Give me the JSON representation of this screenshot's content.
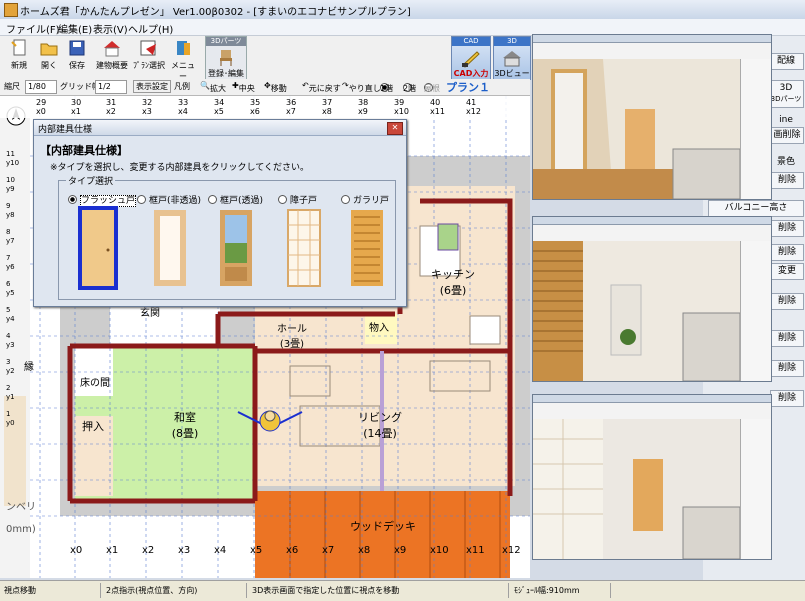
{
  "window": {
    "title": "ホームズ君「かんたんプレゼン」 Ver1.00β0302 - [すまいのエコナビサンプルプラン]"
  },
  "menu": [
    "ファイル(F)",
    "編集(E)",
    "表示(V)",
    "ヘルプ(H)"
  ],
  "toolbar": {
    "buttons": [
      "新規",
      "開く",
      "保存",
      "建物概要",
      "ﾌﾟﾗﾝ選択",
      "メニュー",
      "登録･編集"
    ],
    "parts_group": "3Dパーツ",
    "cad_label": "CAD",
    "cad_button": "CAD入力",
    "view3d_label": "3D",
    "view3d_button": "3Dビュー"
  },
  "toolbar2": {
    "scale_label": "縮尺",
    "scale_value": "1/80",
    "grid_label": "グリッド幅",
    "grid_value": "1/2",
    "display_settings": "表示設定",
    "legend": "凡例",
    "zoom": "拡大",
    "center": "中央",
    "move": "移動",
    "undo": "元に戻す",
    "redo": "やり直し",
    "floor1": "1階",
    "floor2": "2階",
    "roof": "屋根",
    "plan_tab": "プラン１"
  },
  "ruler": {
    "top": [
      "29",
      "30",
      "31",
      "32",
      "33",
      "34",
      "35",
      "36",
      "37",
      "38",
      "39",
      "40",
      "41"
    ],
    "top_sub": [
      "x0",
      "x1",
      "x2",
      "x3",
      "x4",
      "x5",
      "x6",
      "x7",
      "x8",
      "x9",
      "x10",
      "x11",
      "x12"
    ],
    "bottom": [
      "x0",
      "x1",
      "x2",
      "x3",
      "x4",
      "x5",
      "x6",
      "x7",
      "x8",
      "x9",
      "x10",
      "x11",
      "x12"
    ],
    "left": [
      "11",
      "y10",
      "10",
      "y9",
      "9",
      "y8",
      "8",
      "y7",
      "7",
      "y6",
      "6",
      "y5",
      "5",
      "y4",
      "4",
      "y3",
      "3",
      "y2",
      "2",
      "y1",
      "1",
      "y0"
    ]
  },
  "plan": {
    "rooms": [
      {
        "name": "キッチン",
        "size": "(6畳)"
      },
      {
        "name": "物入",
        "size": ""
      },
      {
        "name": "ホール",
        "size": "(3畳)"
      },
      {
        "name": "和室",
        "size": "(8畳)"
      },
      {
        "name": "床の間",
        "size": ""
      },
      {
        "name": "押入",
        "size": ""
      },
      {
        "name": "リビング",
        "size": "(14畳)"
      },
      {
        "name": "ウッドデッキ",
        "size": ""
      },
      {
        "name": "玄関",
        "size": ""
      }
    ],
    "left_fragments": [
      "ンベリ",
      "0mm)",
      "縁"
    ]
  },
  "dialog": {
    "title": "内部建具仕様",
    "heading": "【内部建具仕様】",
    "instruction": "※タイプを選択し、変更する内部建具をクリックしてください。",
    "group_label": "タイプ選択",
    "types": [
      {
        "label": "フラッシュ戸",
        "selected": true
      },
      {
        "label": "框戸(非透過)",
        "selected": false
      },
      {
        "label": "框戸(透過)",
        "selected": false
      },
      {
        "label": "障子戸",
        "selected": false
      },
      {
        "label": "ガラリ戸",
        "selected": false
      }
    ]
  },
  "side_panel": {
    "buttons": [
      "3Dパーツ",
      "ine",
      "画削除",
      "景色",
      "削除",
      "バルコニー高さ",
      "削除",
      "削除",
      "変更",
      "削除",
      "削除",
      "削除",
      "削除"
    ],
    "top_buttons": [
      "配線",
      "3D"
    ]
  },
  "status": {
    "mode": "視点移動",
    "hint": "2点指示(視点位置、方向)",
    "desc": "3D表示画面で指定した位置に視点を移動",
    "module": "ﾓｼﾞｭｰﾙ幅:910mm"
  },
  "colors": {
    "wall": "#8b1a1a",
    "living_floor": "#f7e5cf",
    "washitsu": "#ccf0a8",
    "deck": "#ec7424",
    "grid": "#5b7fd1",
    "selected_outline": "#1a2fd0"
  }
}
